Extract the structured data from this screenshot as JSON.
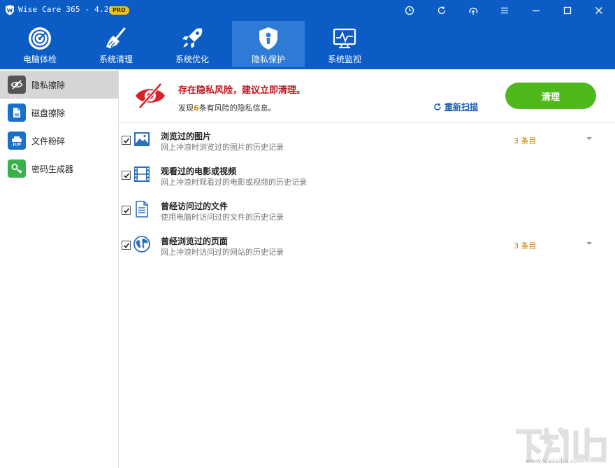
{
  "window": {
    "title": "Wise Care 365 - 4.26",
    "badge": "PRO"
  },
  "nav": {
    "tabs": [
      {
        "label": "电脑体检"
      },
      {
        "label": "系统清理"
      },
      {
        "label": "系统优化"
      },
      {
        "label": "隐私保护",
        "active": true
      },
      {
        "label": "系统监视"
      }
    ]
  },
  "sidebar": {
    "items": [
      {
        "label": "隐私擦除",
        "active": true
      },
      {
        "label": "磁盘擦除"
      },
      {
        "label": "文件粉碎"
      },
      {
        "label": "密码生成器"
      }
    ]
  },
  "banner": {
    "title": "存在隐私风险，建议立即清理。",
    "sub_prefix": "发现",
    "count": "6",
    "sub_suffix": "条有风险的隐私信息。",
    "rescan": "重新扫描",
    "clean_button": "清理"
  },
  "items": [
    {
      "title": "浏览过的图片",
      "desc": "网上冲浪时浏览过的图片的历史记录",
      "count": "3 条目",
      "checked": true
    },
    {
      "title": "观看过的电影或视频",
      "desc": "网上冲浪时观看过的电影或视频的历史记录",
      "count": "",
      "checked": true
    },
    {
      "title": "曾经访问过的文件",
      "desc": "使用电脑时访问过的文件的历史记录",
      "count": "",
      "checked": true
    },
    {
      "title": "曾经浏览过的页面",
      "desc": "网上冲浪时访问过的网站的历史记录",
      "count": "3 条目",
      "checked": true
    }
  ],
  "watermark": {
    "text": "www.xiazaiba.com"
  },
  "colors": {
    "brand": "#0b5cc4",
    "active_tab": "#2d7bd6",
    "clean_button": "#4fb81c",
    "risk": "#c4151c",
    "count": "#c77a00"
  }
}
